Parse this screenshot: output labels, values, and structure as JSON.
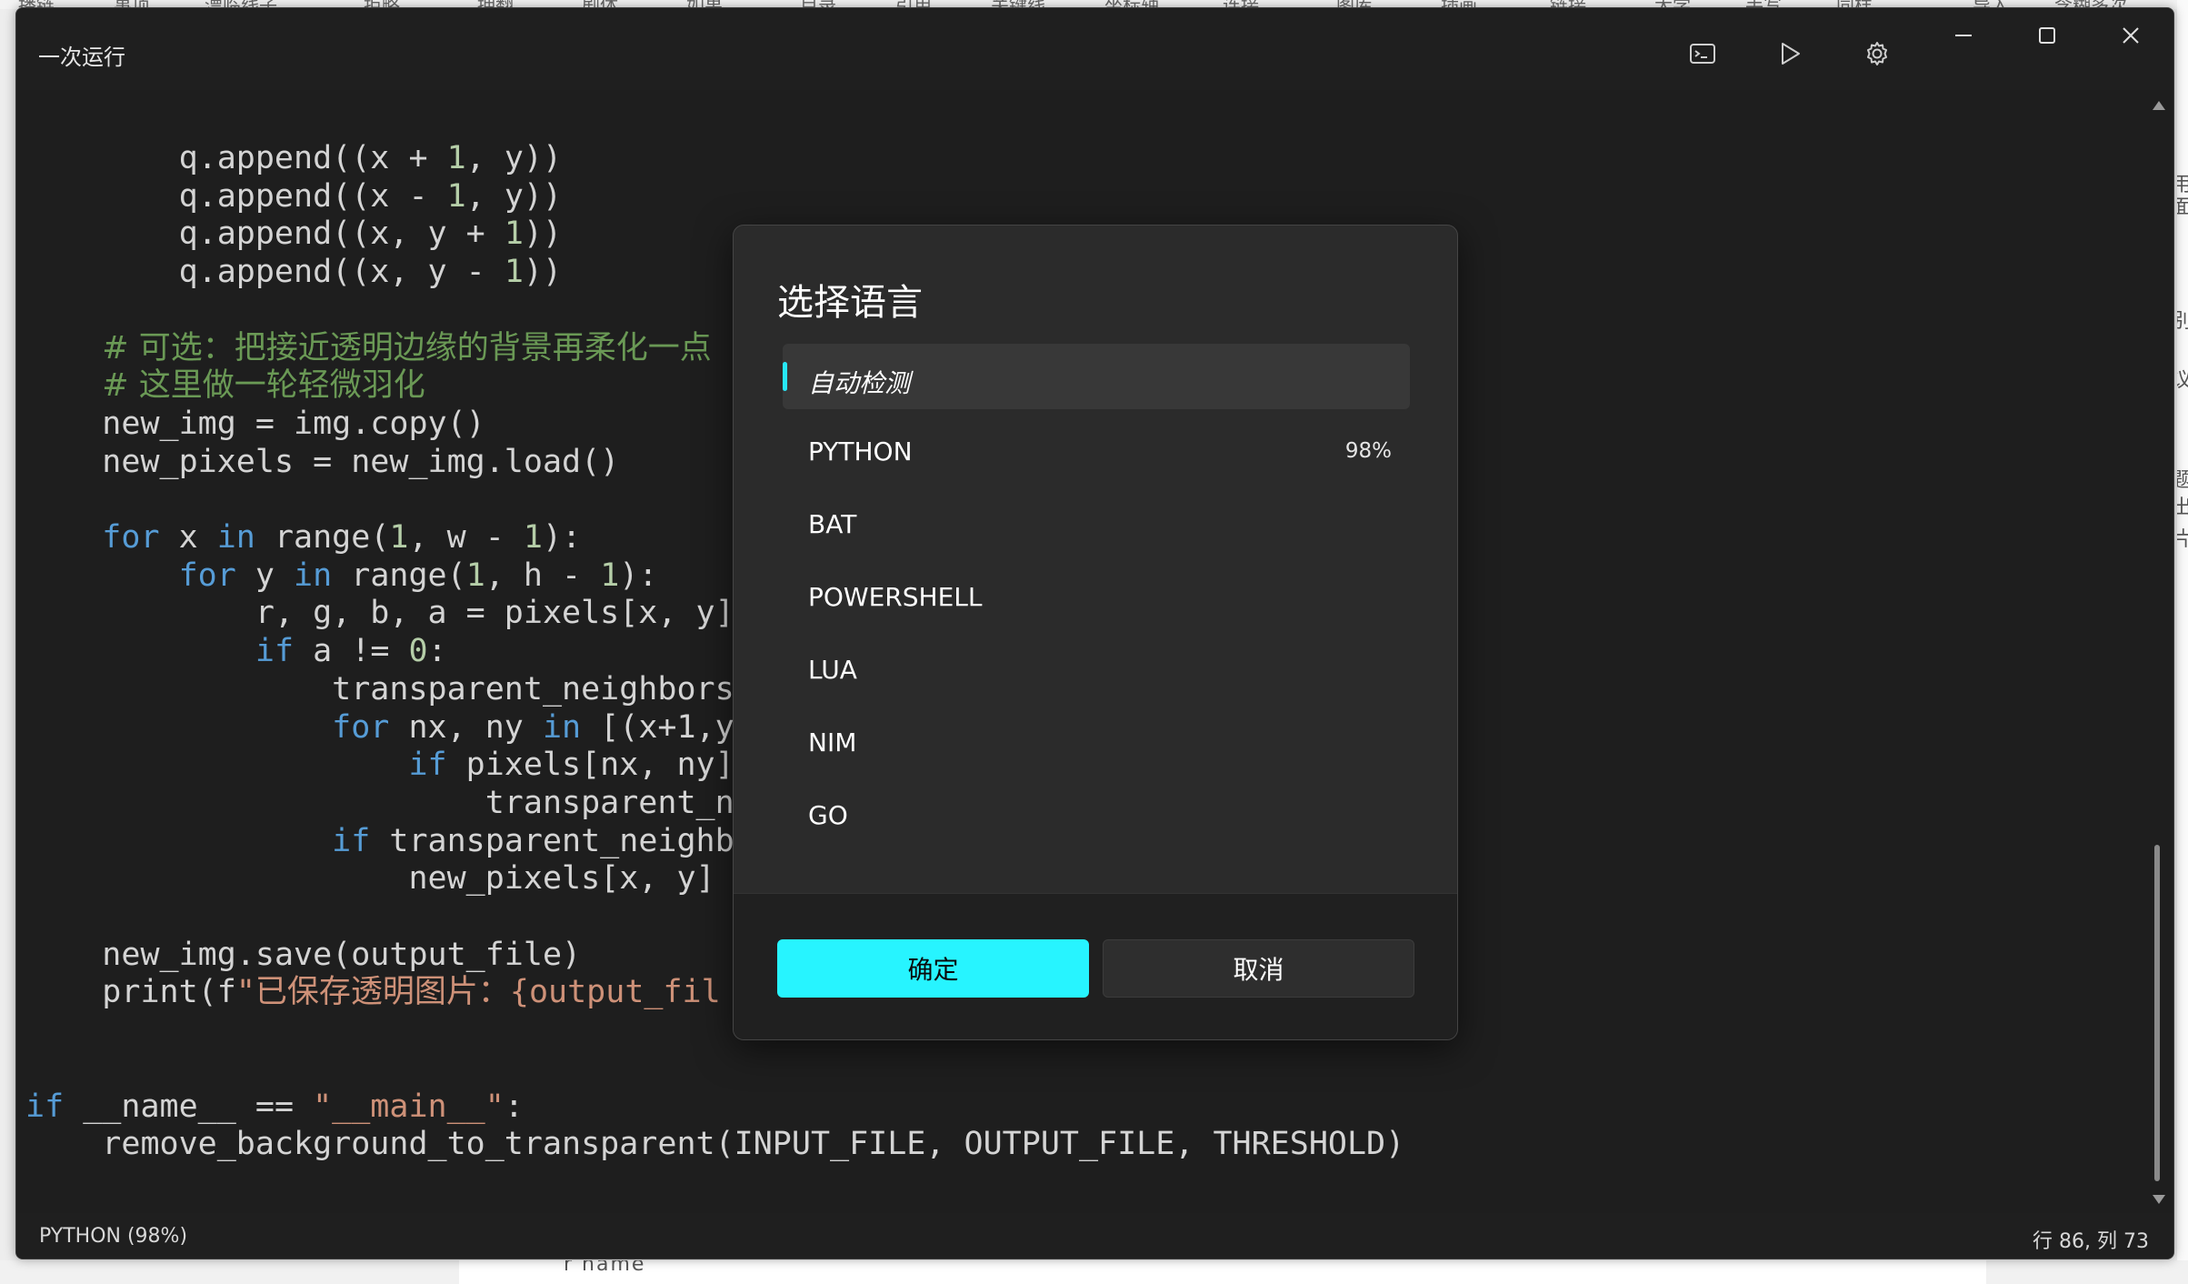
{
  "background_app": {
    "toolbar_fragments": [
      "播链",
      "事项",
      "漂临线子",
      "拒略",
      "拥翻",
      "剧体",
      "如果",
      "目录",
      "引用",
      "关键线",
      "坐标轴",
      "连接",
      "图库",
      "插画",
      "链接",
      "大学",
      "手写",
      "同样",
      "导入",
      "含糊多次"
    ],
    "right_fragments": [
      "用",
      "面",
      "别",
      "议",
      "题",
      "出",
      "片"
    ],
    "bottom_fragment": "  r     name       "
  },
  "window": {
    "title": "一次运行",
    "controls": {
      "terminal_icon": "terminal-icon",
      "run_icon": "play-icon",
      "settings_icon": "gear-icon",
      "minimize_icon": "minimize-icon",
      "maximize_icon": "maximize-icon",
      "close_icon": "close-icon"
    }
  },
  "editor": {
    "lines": [
      {
        "indent": "        ",
        "segments": [
          [
            "q.append((x + ",
            ""
          ],
          [
            "1",
            "num"
          ],
          [
            ", y))",
            ""
          ]
        ]
      },
      {
        "indent": "        ",
        "segments": [
          [
            "q.append((x - ",
            ""
          ],
          [
            "1",
            "num"
          ],
          [
            ", y))",
            ""
          ]
        ]
      },
      {
        "indent": "        ",
        "segments": [
          [
            "q.append((x, y + ",
            ""
          ],
          [
            "1",
            "num"
          ],
          [
            "))",
            ""
          ]
        ]
      },
      {
        "indent": "        ",
        "segments": [
          [
            "q.append((x, y - ",
            ""
          ],
          [
            "1",
            "num"
          ],
          [
            "))",
            ""
          ]
        ]
      },
      {
        "indent": "",
        "segments": [
          [
            "",
            ""
          ]
        ]
      },
      {
        "indent": "    ",
        "segments": [
          [
            "# 可选：把接近透明边缘的背景再柔化一点",
            "cmt"
          ]
        ]
      },
      {
        "indent": "    ",
        "segments": [
          [
            "# 这里做一轮轻微羽化",
            "cmt"
          ]
        ]
      },
      {
        "indent": "    ",
        "segments": [
          [
            "new_img = img.copy()",
            ""
          ]
        ]
      },
      {
        "indent": "    ",
        "segments": [
          [
            "new_pixels = new_img.load()",
            ""
          ]
        ]
      },
      {
        "indent": "",
        "segments": [
          [
            "",
            ""
          ]
        ]
      },
      {
        "indent": "    ",
        "segments": [
          [
            "for",
            "kw"
          ],
          [
            " x ",
            ""
          ],
          [
            "in",
            "kw"
          ],
          [
            " range(",
            ""
          ],
          [
            "1",
            "num"
          ],
          [
            ", w - ",
            ""
          ],
          [
            "1",
            "num"
          ],
          [
            "):",
            ""
          ]
        ]
      },
      {
        "indent": "        ",
        "segments": [
          [
            "for",
            "kw"
          ],
          [
            " y ",
            ""
          ],
          [
            "in",
            "kw"
          ],
          [
            " range(",
            ""
          ],
          [
            "1",
            "num"
          ],
          [
            ", h - ",
            ""
          ],
          [
            "1",
            "num"
          ],
          [
            "):",
            ""
          ]
        ]
      },
      {
        "indent": "            ",
        "segments": [
          [
            "r, g, b, a = pixels[x, y]",
            ""
          ]
        ]
      },
      {
        "indent": "            ",
        "segments": [
          [
            "if",
            "kw"
          ],
          [
            " a != ",
            ""
          ],
          [
            "0",
            "num"
          ],
          [
            ":",
            ""
          ]
        ]
      },
      {
        "indent": "                ",
        "segments": [
          [
            "transparent_neighbors",
            ""
          ]
        ]
      },
      {
        "indent": "                ",
        "segments": [
          [
            "for",
            "kw"
          ],
          [
            " nx, ny ",
            ""
          ],
          [
            "in",
            "kw"
          ],
          [
            " [(x+1,y",
            ""
          ]
        ]
      },
      {
        "indent": "                    ",
        "segments": [
          [
            "if",
            "kw"
          ],
          [
            " pixels[nx, ny]",
            ""
          ]
        ]
      },
      {
        "indent": "                        ",
        "segments": [
          [
            "transparent_n",
            ""
          ]
        ]
      },
      {
        "indent": "                ",
        "segments": [
          [
            "if",
            "kw"
          ],
          [
            " transparent_neighb",
            ""
          ]
        ]
      },
      {
        "indent": "                    ",
        "segments": [
          [
            "new_pixels[x, y]",
            ""
          ]
        ]
      },
      {
        "indent": "",
        "segments": [
          [
            "",
            ""
          ]
        ]
      },
      {
        "indent": "    ",
        "segments": [
          [
            "new_img.save(output_file)",
            ""
          ]
        ]
      },
      {
        "indent": "    ",
        "segments": [
          [
            "print(f",
            ""
          ],
          [
            "\"已保存透明图片：{output_fil",
            "str"
          ]
        ]
      },
      {
        "indent": "",
        "segments": [
          [
            "",
            ""
          ]
        ]
      },
      {
        "indent": "",
        "segments": [
          [
            "",
            ""
          ]
        ]
      },
      {
        "indent": "",
        "segments": [
          [
            "if",
            "kw"
          ],
          [
            " __name__ == ",
            ""
          ],
          [
            "\"__main__\"",
            "str"
          ],
          [
            ":",
            ""
          ]
        ]
      },
      {
        "indent": "    ",
        "segments": [
          [
            "remove_background_to_transparent(INPUT_FILE, OUTPUT_FILE, THRESHOLD)",
            ""
          ]
        ]
      }
    ]
  },
  "statusbar": {
    "language": "PYTHON (98%)",
    "position": "行 86, 列 73"
  },
  "dialog": {
    "title": "选择语言",
    "items": [
      {
        "label": "自动检测",
        "confidence": "",
        "selected": true
      },
      {
        "label": "PYTHON",
        "confidence": "98%",
        "selected": false
      },
      {
        "label": "BAT",
        "confidence": "",
        "selected": false
      },
      {
        "label": "POWERSHELL",
        "confidence": "",
        "selected": false
      },
      {
        "label": "LUA",
        "confidence": "",
        "selected": false
      },
      {
        "label": "NIM",
        "confidence": "",
        "selected": false
      },
      {
        "label": "GO",
        "confidence": "",
        "selected": false
      }
    ],
    "ok_label": "确定",
    "cancel_label": "取消"
  },
  "colors": {
    "accent": "#27f4ff",
    "keyword": "#569cd6",
    "number": "#b5cea8",
    "string": "#ce9178",
    "comment": "#6a9955",
    "editor_background": "#1e1e1e"
  }
}
